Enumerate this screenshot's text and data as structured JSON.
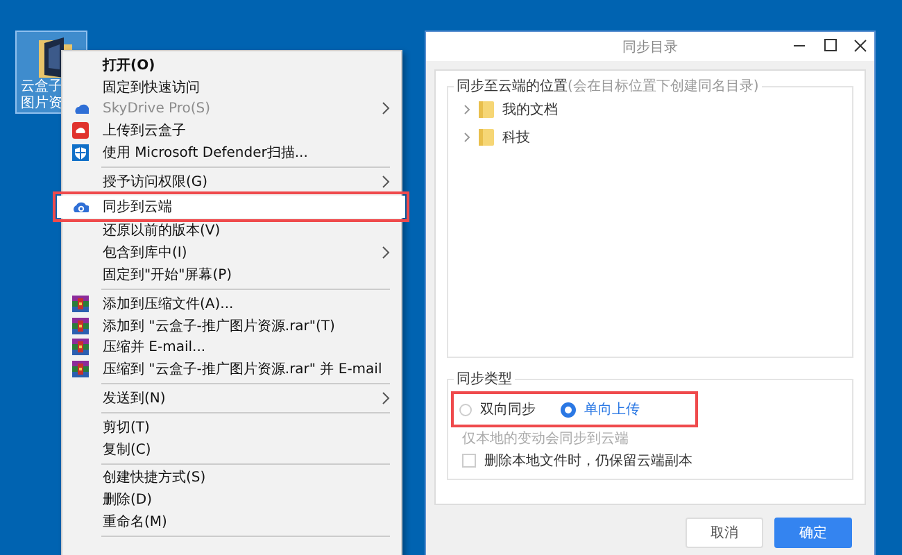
{
  "desktop_icon": {
    "label_lines": [
      "云盒子",
      "图片资"
    ],
    "selected": true
  },
  "context_menu": {
    "items": [
      {
        "kind": "plain",
        "label": "打开(O)",
        "default": true,
        "disabled": false,
        "submenu": false,
        "highlighted": false
      },
      {
        "kind": "plain",
        "label": "固定到快速访问",
        "default": false,
        "disabled": false,
        "submenu": false,
        "highlighted": false
      },
      {
        "kind": "cloud",
        "label": "SkyDrive Pro(S)",
        "default": false,
        "disabled": true,
        "submenu": true,
        "highlighted": false
      },
      {
        "kind": "box",
        "label": "上传到云盒子",
        "default": false,
        "disabled": false,
        "submenu": false,
        "highlighted": false
      },
      {
        "kind": "shield",
        "label": "使用 Microsoft Defender扫描...",
        "default": false,
        "disabled": false,
        "submenu": false,
        "highlighted": false
      },
      {
        "kind": "separator"
      },
      {
        "kind": "plain",
        "label": "授予访问权限(G)",
        "default": false,
        "disabled": false,
        "submenu": true,
        "highlighted": false
      },
      {
        "kind": "sync",
        "label": "同步到云端",
        "default": false,
        "disabled": false,
        "submenu": false,
        "highlighted": true
      },
      {
        "kind": "plain",
        "label": "还原以前的版本(V)",
        "default": false,
        "disabled": false,
        "submenu": false,
        "highlighted": false
      },
      {
        "kind": "plain",
        "label": "包含到库中(I)",
        "default": false,
        "disabled": false,
        "submenu": true,
        "highlighted": false
      },
      {
        "kind": "plain",
        "label": "固定到\"开始\"屏幕(P)",
        "default": false,
        "disabled": false,
        "submenu": false,
        "highlighted": false
      },
      {
        "kind": "separator"
      },
      {
        "kind": "archive",
        "label": "添加到压缩文件(A)...",
        "default": false,
        "disabled": false,
        "submenu": false,
        "highlighted": false
      },
      {
        "kind": "archive",
        "label": "添加到 \"云盒子-推广图片资源.rar\"(T)",
        "default": false,
        "disabled": false,
        "submenu": false,
        "highlighted": false
      },
      {
        "kind": "archive",
        "label": "压缩并 E-mail...",
        "default": false,
        "disabled": false,
        "submenu": false,
        "highlighted": false
      },
      {
        "kind": "archive",
        "label": "压缩到 \"云盒子-推广图片资源.rar\" 并 E-mail",
        "default": false,
        "disabled": false,
        "submenu": false,
        "highlighted": false
      },
      {
        "kind": "separator"
      },
      {
        "kind": "plain",
        "label": "发送到(N)",
        "default": false,
        "disabled": false,
        "submenu": true,
        "highlighted": false
      },
      {
        "kind": "separator"
      },
      {
        "kind": "plain",
        "label": "剪切(T)",
        "default": false,
        "disabled": false,
        "submenu": false,
        "highlighted": false
      },
      {
        "kind": "plain",
        "label": "复制(C)",
        "default": false,
        "disabled": false,
        "submenu": false,
        "highlighted": false
      },
      {
        "kind": "separator"
      },
      {
        "kind": "plain",
        "label": "创建快捷方式(S)",
        "default": false,
        "disabled": false,
        "submenu": false,
        "highlighted": false
      },
      {
        "kind": "plain",
        "label": "删除(D)",
        "default": false,
        "disabled": false,
        "submenu": false,
        "highlighted": false
      },
      {
        "kind": "plain",
        "label": "重命名(M)",
        "default": false,
        "disabled": false,
        "submenu": false,
        "highlighted": false
      },
      {
        "kind": "separator"
      }
    ]
  },
  "dialog": {
    "title": "同步目录",
    "location_group": {
      "title": "同步至云端的位置",
      "hint": "(会在目标位置下创建同名目录)",
      "tree": [
        {
          "label": "我的文档",
          "expanded": false
        },
        {
          "label": "科技",
          "expanded": false
        }
      ]
    },
    "type_group": {
      "title": "同步类型",
      "highlighted": true,
      "options": [
        {
          "label": "双向同步",
          "selected": false
        },
        {
          "label": "单向上传",
          "selected": true
        }
      ],
      "description": "仅本地的变动会同步到云端",
      "checkbox": {
        "label": "删除本地文件时，仍保留云端副本",
        "checked": false
      }
    },
    "buttons": [
      {
        "label": "取消",
        "primary": false
      },
      {
        "label": "确定",
        "primary": true
      }
    ]
  }
}
